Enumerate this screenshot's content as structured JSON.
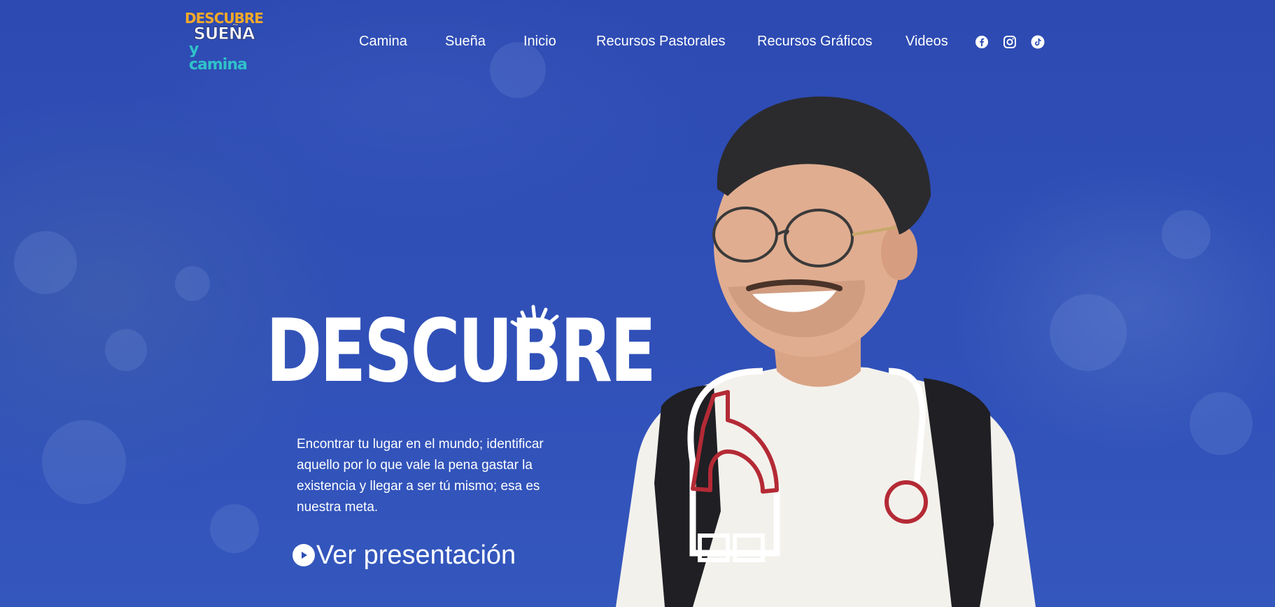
{
  "logo": {
    "line1": "DESCUBRE",
    "line2": "SUEÑA",
    "line3": "y camina",
    "alt": "Descubre Sueña y Camina"
  },
  "nav": {
    "items": [
      {
        "label": "Camina"
      },
      {
        "label": "Sueña"
      },
      {
        "label": "Inicio"
      },
      {
        "label": "Recursos Pastorales"
      },
      {
        "label": "Recursos Gráficos"
      },
      {
        "label": "Videos"
      }
    ],
    "social": [
      {
        "icon": "facebook-icon"
      },
      {
        "icon": "instagram-icon"
      },
      {
        "icon": "tiktok-icon"
      }
    ]
  },
  "hero": {
    "title": "DESCUBRE",
    "description": "Encontrar tu lugar en el mundo; identificar aquello por lo que vale la pena gastar la existencia y llegar a ser tú mismo; esa es nuestra meta.",
    "cta_label": "Ver presentación",
    "cta_icon": "play-circle-icon"
  },
  "colors": {
    "background": "#2f4fb5",
    "text": "#ffffff",
    "accent_red": "#b42a35",
    "logo_orange": "#f4a928",
    "logo_teal": "#2fc2c9"
  }
}
